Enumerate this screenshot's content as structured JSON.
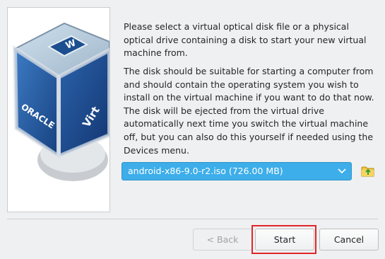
{
  "logo": {
    "oracle_text": "ORACLE",
    "virt_text": "Virt"
  },
  "instructions": {
    "paragraph1": "Please select a virtual optical disk file or a physical optical drive containing a disk to start your new virtual machine from.",
    "paragraph2": "The disk should be suitable for starting a computer from and should contain the operating system you wish to install on the virtual machine if you want to do that now. The disk will be ejected from the virtual drive automatically next time you switch the virtual machine off, but you can also do this yourself if needed using the Devices menu."
  },
  "disk_selector": {
    "selected": "android-x86-9.0-r2.iso (726.00 MB)"
  },
  "icons": {
    "dropdown": "chevron-down-icon",
    "choose_file": "folder-icon"
  },
  "buttons": {
    "back": "< Back",
    "start": "Start",
    "cancel": "Cancel"
  },
  "colors": {
    "selection": "#3daee9",
    "highlight": "#e0262a"
  }
}
